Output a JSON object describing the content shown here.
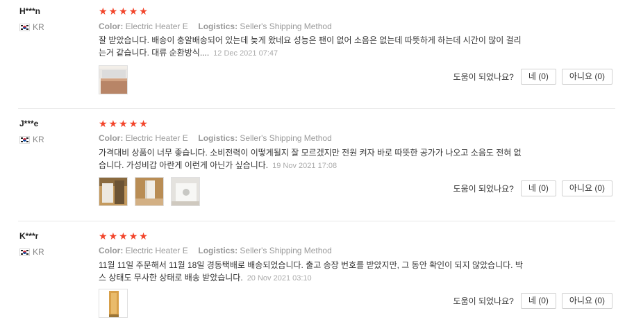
{
  "labels": {
    "color_label": "Color:",
    "logistics_label": "Logistics:",
    "helpful_question": "도움이 되었나요?"
  },
  "colors": {
    "star": "#f2452b",
    "divider": "#e8e8e8"
  },
  "reviews": [
    {
      "user": "H***n",
      "country": "KR",
      "rating": 5,
      "color": "Electric Heater E",
      "logistics": "Seller's Shipping Method",
      "text_line1": "잘 받았습니다. 배송이 충알배송되어 있는데 늦게 왔네요 성능은 팬이 없어 소음은 없는데 따뜻하게 하는데 시간이 많이 걸리",
      "text_line2": "는거 같습니다. 대류 순환방식....",
      "date": "12 Dec 2021 07:47",
      "yes_label": "네 (0)",
      "no_label": "아니요 (0)",
      "photos": [
        "heater-photo"
      ]
    },
    {
      "user": "J***e",
      "country": "KR",
      "rating": 5,
      "color": "Electric Heater E",
      "logistics": "Seller's Shipping Method",
      "text_line1": "가격대비 상품이 너무 좋습니다. 소비전력이 이떻게될지 잘 모르겠지만 전원 켜자 바로 따뜻한 공가가 나오고 소음도 전혀 없",
      "text_line2": "습니다. 가성비갑 아란게 이런게 아닌가 싶습니다.",
      "date": "19 Nov 2021 17:08",
      "yes_label": "네 (0)",
      "no_label": "아니요 (0)",
      "photos": [
        "heater-photo",
        "heater-photo",
        "heater-photo"
      ]
    },
    {
      "user": "K***r",
      "country": "KR",
      "rating": 5,
      "color": "Electric Heater E",
      "logistics": "Seller's Shipping Method",
      "text_line1": "11월 11일 주문해서 11월 18일 경동택배로 배송되었습니다. 출고 송장 번호를 받았지만, 그 동안 확인이 되지 않았습니다. 박",
      "text_line2": "스 상태도 무사한 상태로 배송 받았습니다.",
      "date": "20 Nov 2021 03:10",
      "yes_label": "네 (0)",
      "no_label": "아니요 (0)",
      "photos": [
        "heater-photo"
      ]
    }
  ]
}
